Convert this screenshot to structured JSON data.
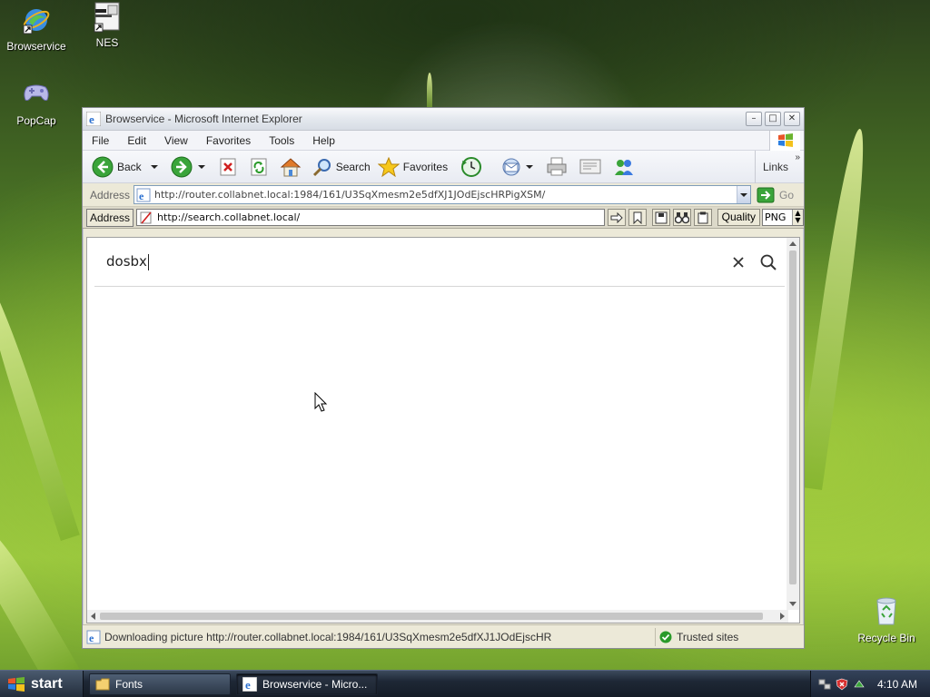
{
  "desktop": {
    "icons": [
      {
        "label": "Browservice",
        "icon": "ie-shortcut-icon"
      },
      {
        "label": "NES",
        "icon": "nes-document-icon"
      },
      {
        "label": "PopCap",
        "icon": "gamepad-icon"
      }
    ],
    "recycle_bin": {
      "label": "Recycle Bin",
      "icon": "recycle-bin-icon"
    }
  },
  "window": {
    "title": "Browservice - Microsoft Internet Explorer",
    "menu": [
      "File",
      "Edit",
      "View",
      "Favorites",
      "Tools",
      "Help"
    ],
    "toolbar": {
      "back_label": "Back",
      "search_label": "Search",
      "favorites_label": "Favorites",
      "links_label": "Links"
    },
    "address": {
      "label": "Address",
      "url": "http://router.collabnet.local:1984/161/U3SqXmesm2e5dfXJ1JOdEjscHRPigXSM/",
      "go_label": "Go"
    },
    "proxy_bar": {
      "label": "Address",
      "url": "http://search.collabnet.local/",
      "quality_label": "Quality",
      "quality_value": "PNG"
    },
    "page": {
      "search_value": "dosbx"
    },
    "status": {
      "text": "Downloading picture http://router.collabnet.local:1984/161/U3SqXmesm2e5dfXJ1JOdEjscHR",
      "zone": "Trusted sites"
    }
  },
  "taskbar": {
    "start_label": "start",
    "tasks": [
      {
        "label": "Fonts",
        "icon": "folder-icon",
        "active": false
      },
      {
        "label": "Browservice - Micro...",
        "icon": "ie-icon",
        "active": true
      }
    ],
    "clock": "4:10 AM"
  },
  "colors": {
    "ie_blue": "#2a6fd0",
    "go_green": "#3aa43a",
    "taskbar": "#1e2836"
  }
}
